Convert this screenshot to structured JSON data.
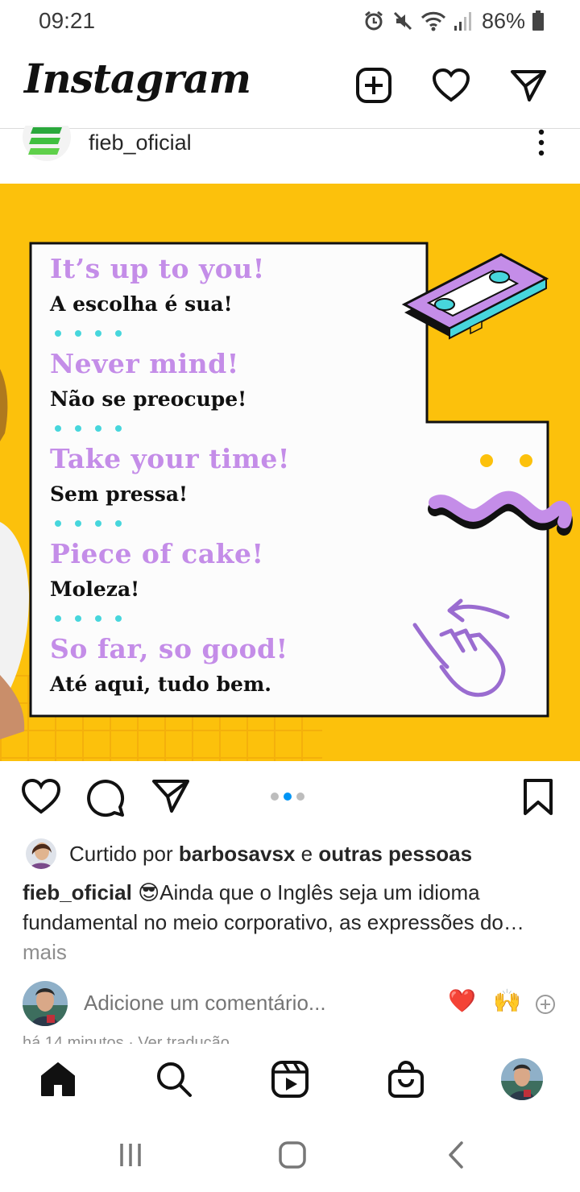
{
  "status_bar": {
    "time": "09:21",
    "battery": "86%",
    "icons": [
      "alarm-icon",
      "mute-icon",
      "wifi-icon",
      "signal-icon",
      "battery-icon"
    ]
  },
  "header": {
    "logo": "Instagram",
    "icons": [
      "new-post-icon",
      "heart-icon",
      "direct-message-icon"
    ]
  },
  "post": {
    "username": "fieb_oficial",
    "image": {
      "phrases": [
        {
          "en": "It’s up to you!",
          "pt": "A escolha é sua!"
        },
        {
          "en": "Never mind!",
          "pt": "Não se preocupe!"
        },
        {
          "en": "Take your time!",
          "pt": "Sem pressa!"
        },
        {
          "en": "Piece of cake!",
          "pt": "Moleza!"
        },
        {
          "en": "So far, so good!",
          "pt": "Até aqui, tudo bem."
        }
      ],
      "colors": {
        "background": "#fcc10c",
        "accent_purple": "#c48de8",
        "accent_cyan": "#47d6dc"
      }
    },
    "carousel": {
      "count": 3,
      "active_index": 1
    },
    "likes": {
      "prefix": "Curtido por",
      "user": "barbosavsx",
      "conjunction": "e",
      "others": "outras pessoas"
    },
    "caption": {
      "username": "fieb_oficial",
      "emoji": "😎",
      "line1": "Ainda que o Inglês seja um idioma",
      "line2": "fundamental no meio corporativo, as expressões do…",
      "more": "mais"
    },
    "comment": {
      "placeholder": "Adicione um comentário...",
      "quick_emojis": [
        "❤️",
        "🙌"
      ]
    },
    "timestamp": "há 14 minutos · Ver tradução"
  },
  "tabbar": {
    "items": [
      "home-icon",
      "search-icon",
      "reels-icon",
      "shop-icon",
      "profile-avatar"
    ]
  },
  "system_nav": {
    "items": [
      "recents-button",
      "home-button",
      "back-button"
    ]
  },
  "colors": {
    "link_blue": "#0095f6",
    "secondary_text": "#8e8e8e",
    "like_red": "#ed4956"
  }
}
